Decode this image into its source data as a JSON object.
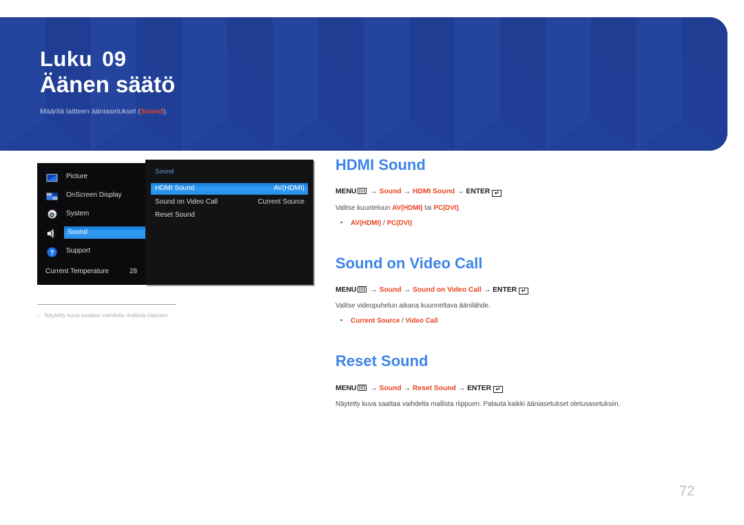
{
  "banner": {
    "chapter_word": "Luku",
    "chapter_number": "09",
    "title": "Äänen säätö",
    "subtitle_pre": "Määritä laitteen ääniasetukset (",
    "subtitle_highlight": "Sound",
    "subtitle_post": ").",
    "bg_color": "#21409a",
    "highlight_color": "#e8441f"
  },
  "osd": {
    "sidebar": {
      "items": [
        {
          "label": "Picture",
          "icon": "picture-icon",
          "selected": false
        },
        {
          "label": "OnScreen Display",
          "icon": "onscreen-display-icon",
          "selected": false
        },
        {
          "label": "System",
          "icon": "gear-icon",
          "selected": false
        },
        {
          "label": "Sound",
          "icon": "speaker-icon",
          "selected": true
        },
        {
          "label": "Support",
          "icon": "question-circle-icon",
          "selected": false
        }
      ],
      "status_label": "Current Temperature",
      "status_value": "28"
    },
    "panel": {
      "title": "Sound",
      "rows": [
        {
          "label": "HDMI Sound",
          "value": "AV(HDMI)",
          "selected": true
        },
        {
          "label": "Sound on Video Call",
          "value": "Current Source",
          "selected": false
        },
        {
          "label": "Reset Sound",
          "value": "",
          "selected": false
        }
      ]
    },
    "selection_color": "#2f9bf2"
  },
  "footnote": {
    "dash": "‒",
    "text": "Näytetty kuva saattaa vaihdella mallista riippuen."
  },
  "content": {
    "sections": [
      {
        "heading": "HDMI Sound",
        "path": {
          "menu_label": "MENU",
          "menu_icon": "menu-grid-icon",
          "steps": [
            "Sound",
            "HDMI Sound"
          ],
          "enter_label": "ENTER",
          "enter_icon": "enter-return-icon",
          "arrow": "→"
        },
        "description_parts": [
          {
            "text": "Valitse kuunteluun ",
            "style": "normal"
          },
          {
            "text": "AV(HDMI)",
            "style": "bold-red"
          },
          {
            "text": " tai ",
            "style": "normal"
          },
          {
            "text": "PC(DVI)",
            "style": "bold-red"
          },
          {
            "text": ".",
            "style": "normal"
          }
        ],
        "options": "AV(HDMI) / PC(DVI)",
        "option_list": [
          "AV(HDMI)",
          "PC(DVI)"
        ]
      },
      {
        "heading": "Sound on Video Call",
        "path": {
          "menu_label": "MENU",
          "menu_icon": "menu-grid-icon",
          "steps": [
            "Sound",
            "Sound on Video Call"
          ],
          "enter_label": "ENTER",
          "enter_icon": "enter-return-icon",
          "arrow": "→"
        },
        "description_parts": [
          {
            "text": "Valitse videopuhelun aikana kuunneltava äänilähde.",
            "style": "normal"
          }
        ],
        "options": "Current Source / Video Call",
        "option_list": [
          "Current Source",
          "Video Call"
        ]
      },
      {
        "heading": "Reset Sound",
        "path": {
          "menu_label": "MENU",
          "menu_icon": "menu-grid-icon",
          "steps": [
            "Sound",
            "Reset Sound"
          ],
          "enter_label": "ENTER",
          "enter_icon": "enter-return-icon",
          "arrow": "→"
        },
        "description_parts": [
          {
            "text": "Näytetty kuva saattaa vaihdella mallista riippuen. Palauta kaikki ääniasetukset oletusasetuksiin.",
            "style": "normal"
          }
        ],
        "options": "",
        "option_list": []
      }
    ],
    "heading_color": "#3c84e8",
    "accent_color": "#e8441f"
  },
  "page_number": "72"
}
